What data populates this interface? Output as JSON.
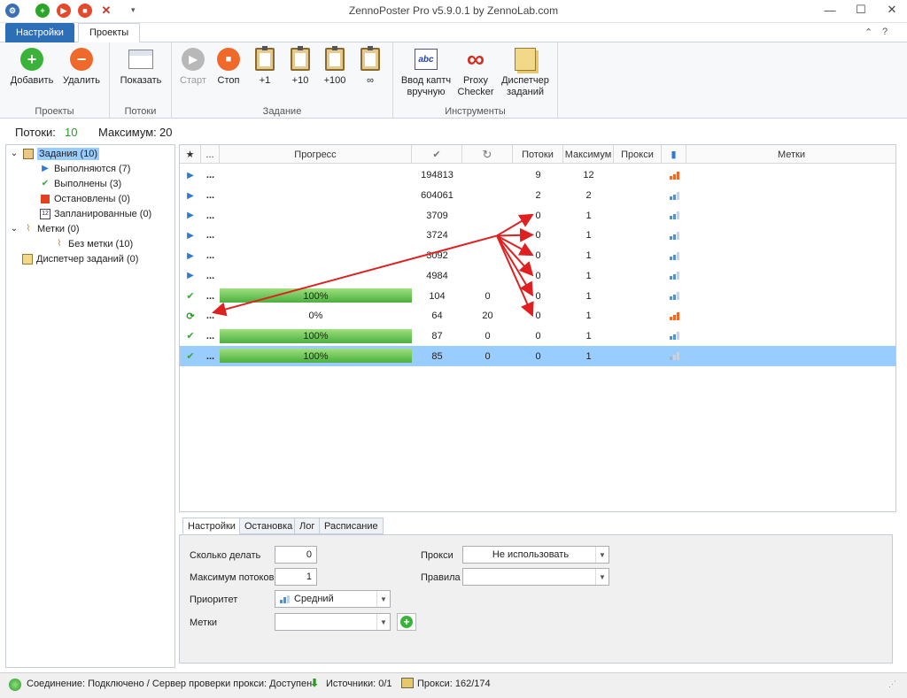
{
  "window": {
    "title": "ZennoPoster Pro v5.9.0.1 by ZennoLab.com"
  },
  "ribbon_tabs": [
    "Настройки",
    "Проекты"
  ],
  "ribbon": {
    "groups": {
      "projects": "Проекты",
      "threads": "Потоки",
      "task": "Задание",
      "tools": "Инструменты"
    },
    "add": "Добавить",
    "delete": "Удалить",
    "show": "Показать",
    "start": "Старт",
    "stop": "Стоп",
    "plus1": "+1",
    "plus10": "+10",
    "plus100": "+100",
    "infinity": "∞",
    "captcha": [
      "Ввод каптч",
      "вручную"
    ],
    "proxy": [
      "Proxy",
      "Checker"
    ],
    "dispatcher": [
      "Диспетчер",
      "заданий"
    ]
  },
  "stats": {
    "threads_label": "Потоки:",
    "threads_value": "10",
    "max_label": "Максимум:",
    "max_value": "20"
  },
  "tree": [
    {
      "label": "Задания (10)",
      "level": 0,
      "icon": "clipboard-icon",
      "selected": true
    },
    {
      "label": "Выполняются (7)",
      "level": 1,
      "icon": "play-icon"
    },
    {
      "label": "Выполнены (3)",
      "level": 1,
      "icon": "check-icon"
    },
    {
      "label": "Остановлены (0)",
      "level": 1,
      "icon": "stop-icon"
    },
    {
      "label": "Запланированные (0)",
      "level": 1,
      "icon": "calendar-icon"
    },
    {
      "label": "Метки (0)",
      "level": 0,
      "icon": "tag-icon"
    },
    {
      "label": "Без метки (10)",
      "level": 2,
      "icon": "tag-icon"
    },
    {
      "label": "Диспетчер заданий (0)",
      "level": 0,
      "icon": "dispatcher-icon"
    }
  ],
  "grid": {
    "headers": {
      "star": "★",
      "name": "...",
      "progress": "Прогресс",
      "done": "✔",
      "retry": "↻",
      "threads": "Потоки",
      "max": "Максимум",
      "proxy": "Прокси",
      "priority": "▮",
      "labels": "Метки"
    },
    "rows": [
      {
        "status": "play",
        "name": "...",
        "progress": "",
        "progress_frac": 0,
        "done": "194813",
        "retry": "",
        "threads": "9",
        "max": "12",
        "priority": "high"
      },
      {
        "status": "play",
        "name": "...",
        "progress": "",
        "progress_frac": 0,
        "done": "604061",
        "retry": "",
        "threads": "2",
        "max": "2",
        "priority": "med"
      },
      {
        "status": "play",
        "name": "...",
        "progress": "",
        "progress_frac": 0,
        "done": "3709",
        "retry": "",
        "threads": "0",
        "max": "1",
        "priority": "med"
      },
      {
        "status": "play",
        "name": "...",
        "progress": "",
        "progress_frac": 0,
        "done": "3724",
        "retry": "",
        "threads": "0",
        "max": "1",
        "priority": "med"
      },
      {
        "status": "play",
        "name": "...",
        "progress": "",
        "progress_frac": 0,
        "done": "3092",
        "retry": "",
        "threads": "0",
        "max": "1",
        "priority": "med"
      },
      {
        "status": "play",
        "name": "...",
        "progress": "",
        "progress_frac": 0,
        "done": "4984",
        "retry": "",
        "threads": "0",
        "max": "1",
        "priority": "med"
      },
      {
        "status": "check",
        "name": "...",
        "progress": "100%",
        "progress_frac": 1,
        "done": "104",
        "retry": "0",
        "threads": "0",
        "max": "1",
        "priority": "med"
      },
      {
        "status": "refresh",
        "name": "...",
        "progress": "0%",
        "progress_frac": 0,
        "done": "64",
        "retry": "20",
        "threads": "0",
        "max": "1",
        "priority": "high"
      },
      {
        "status": "check",
        "name": "...",
        "progress": "100%",
        "progress_frac": 1,
        "done": "87",
        "retry": "0",
        "threads": "0",
        "max": "1",
        "priority": "med"
      },
      {
        "status": "check",
        "name": "...",
        "progress": "100%",
        "progress_frac": 1,
        "done": "85",
        "retry": "0",
        "threads": "0",
        "max": "1",
        "priority": "low",
        "selected": true
      }
    ]
  },
  "bottom_tabs": [
    "Настройки",
    "Остановка",
    "Лог",
    "Расписание"
  ],
  "settings": {
    "how_many_label": "Сколько делать",
    "how_many_value": "0",
    "max_threads_label": "Максимум потоков",
    "max_threads_value": "1",
    "priority_label": "Приоритет",
    "priority_value": "Средний",
    "labels_label": "Метки",
    "labels_value": "",
    "proxy_label": "Прокси",
    "proxy_value": "Не использовать",
    "rules_label": "Правила",
    "rules_value": ""
  },
  "statusbar": {
    "connection": "Соединение: Подключено / Сервер проверки прокси: Доступен",
    "sources": "Источники: 0/1",
    "proxies": "Прокси: 162/174"
  },
  "colors": {
    "accent": "#2c6fb7",
    "selected_row": "#99ccff",
    "progress": "#4caf3f",
    "arrow": "#e02020"
  }
}
